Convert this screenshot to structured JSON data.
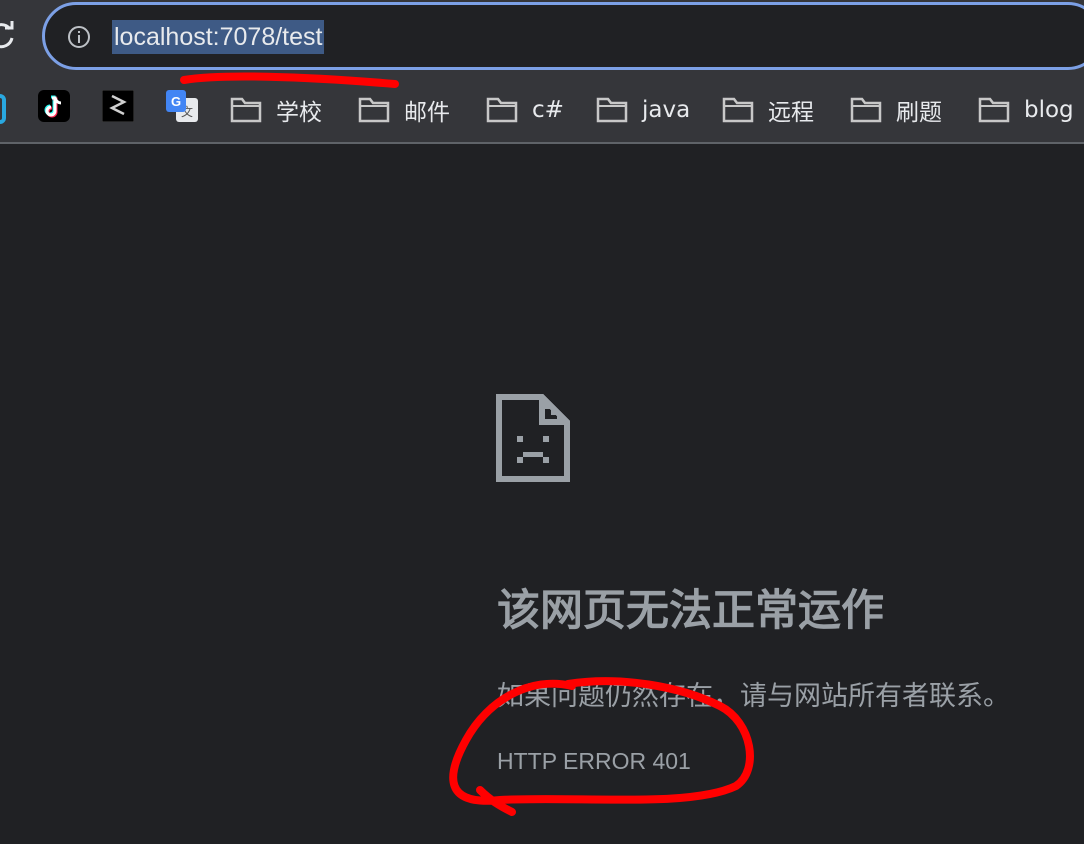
{
  "address_bar": {
    "url": "localhost:7078/test",
    "selection_color": "#3e5a85"
  },
  "bookmarks": [
    {
      "icon": "tiktok-icon"
    },
    {
      "icon": "app-icon"
    },
    {
      "icon": "google-translate-icon"
    },
    {
      "label": "学校",
      "icon": "folder-icon"
    },
    {
      "label": "邮件",
      "icon": "folder-icon"
    },
    {
      "label": "c#",
      "icon": "folder-icon"
    },
    {
      "label": "java",
      "icon": "folder-icon"
    },
    {
      "label": "远程",
      "icon": "folder-icon"
    },
    {
      "label": "刷题",
      "icon": "folder-icon"
    },
    {
      "label": "blog",
      "icon": "folder-icon"
    }
  ],
  "error_page": {
    "icon": "sad-page-icon",
    "title": "该网页无法正常运作",
    "description": "如果问题仍然存在，请与网站所有者联系。",
    "error_code": "HTTP ERROR 401"
  },
  "colors": {
    "background": "#202124",
    "toolbar": "#35363a",
    "omnibox_border": "#7ca0e6",
    "annotation": "#ff0000",
    "text_muted": "#9aa0a6"
  }
}
